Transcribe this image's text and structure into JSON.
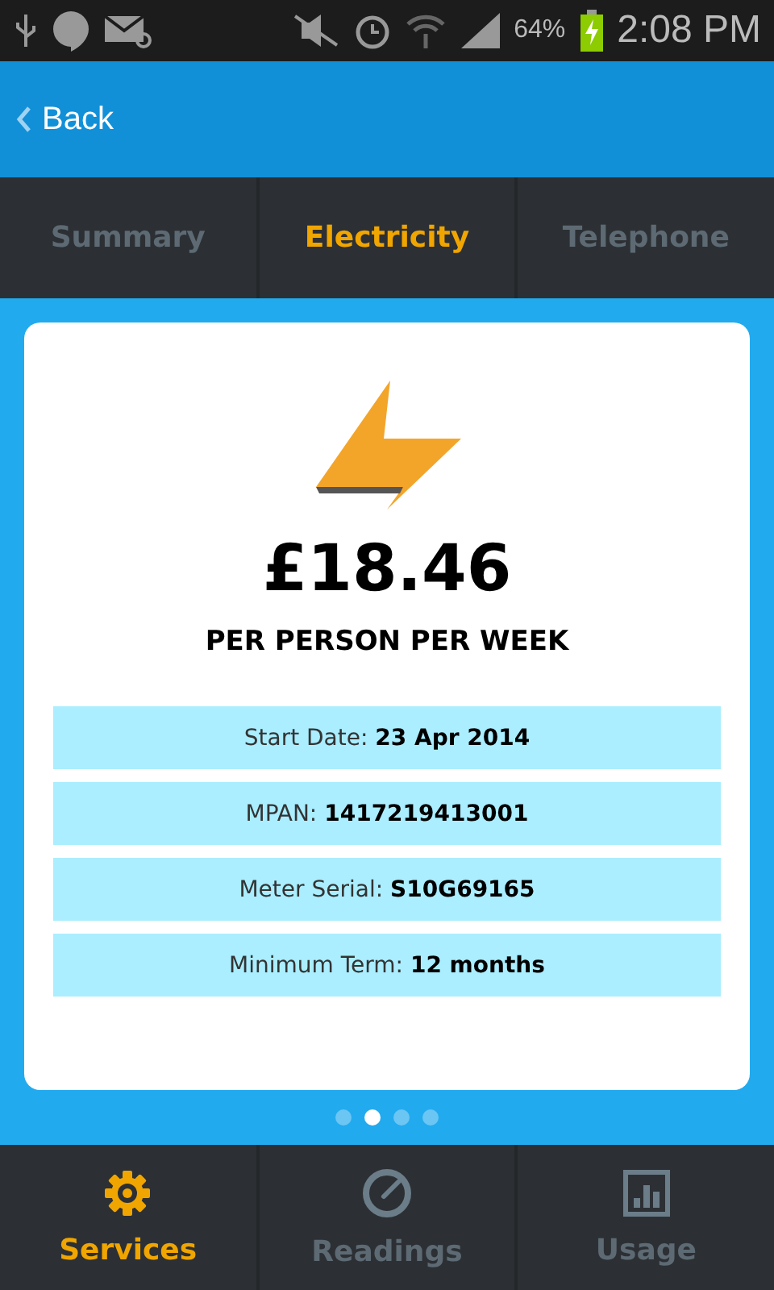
{
  "status_bar": {
    "battery": "64%",
    "time": "2:08 PM"
  },
  "header": {
    "back": "Back"
  },
  "tabs": [
    {
      "label": "Summary",
      "selected": false
    },
    {
      "label": "Electricity",
      "selected": true
    },
    {
      "label": "Telephone",
      "selected": false
    }
  ],
  "card": {
    "price": "£18.46",
    "subtitle": "PER PERSON PER WEEK",
    "details": [
      "Start Date: **23 Apr 2014**",
      "MPAN: **1417219413001**",
      "Meter Serial: **S10G69165**",
      "Minimum Term: **12 months**"
    ]
  },
  "pages": [
    {
      "selected": false
    },
    {
      "selected": true
    },
    {
      "selected": false
    },
    {
      "selected": false
    }
  ],
  "nav": [
    {
      "label": "Services",
      "selected": true
    },
    {
      "label": "Readings",
      "selected": false
    },
    {
      "label": "Usage",
      "selected": false
    }
  ]
}
